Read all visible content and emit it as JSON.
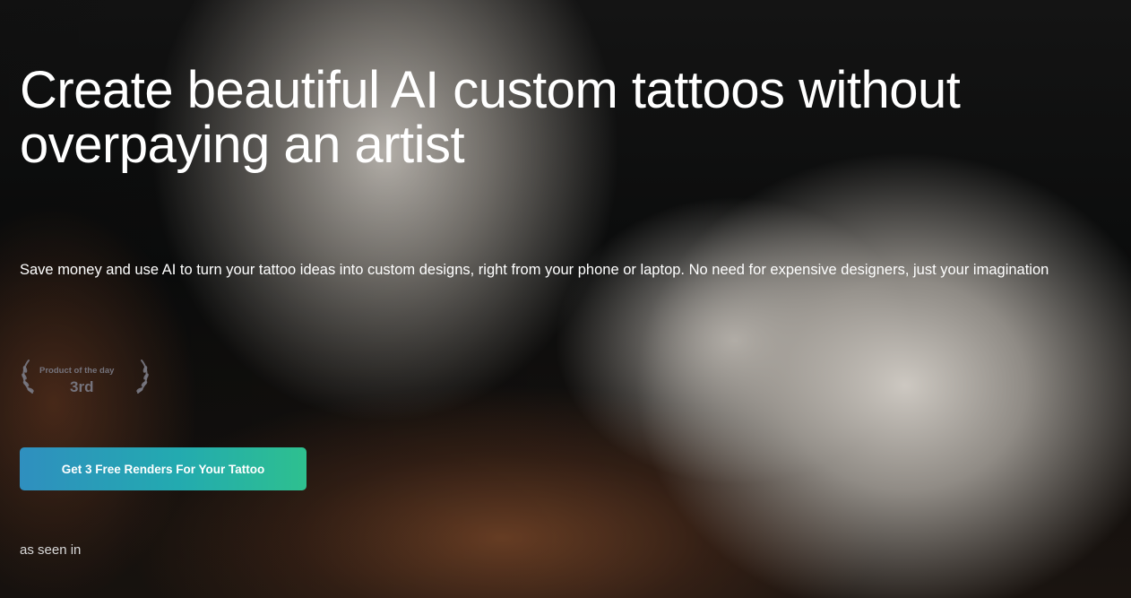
{
  "hero": {
    "title": "Create beautiful AI custom tattoos without overpaying an artist",
    "subtitle": "Save money and use AI to turn your tattoo ideas into custom designs, right from your phone or laptop. No need for expensive designers, just your imagination",
    "badge": {
      "label": "Product of the day",
      "rank": "3rd"
    },
    "cta_label": "Get 3 Free Renders For Your Tattoo",
    "as_seen_in": "as seen in"
  },
  "colors": {
    "cta_gradient_start": "#2f8fbf",
    "cta_gradient_end": "#2ec08f",
    "text": "#ffffff"
  }
}
